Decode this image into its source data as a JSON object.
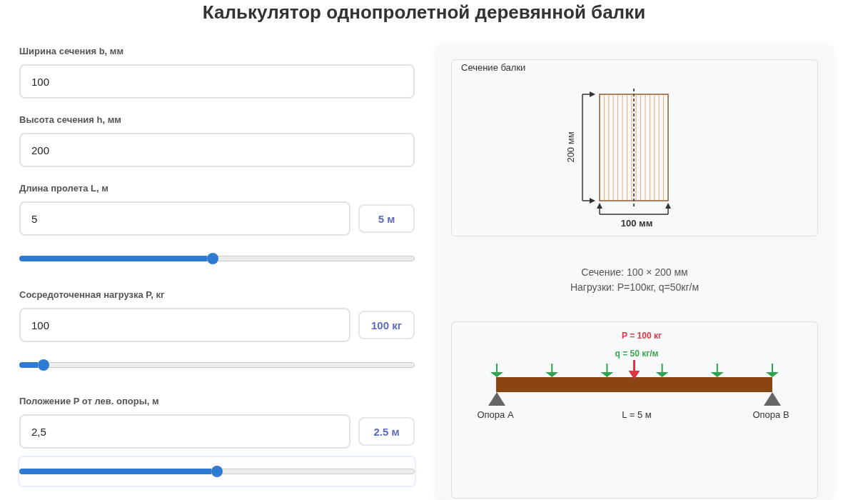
{
  "title": "Калькулятор однопролетной деревянной балки",
  "fields": [
    {
      "kind": "input",
      "label": "Ширина сечения b, мм",
      "value": "100"
    },
    {
      "kind": "input",
      "label": "Высота сечения h, мм",
      "value": "200"
    },
    {
      "kind": "slider",
      "label": "Длина пролета L, м",
      "value": "5",
      "badge": "5 м",
      "level": 0.49,
      "focused": false
    },
    {
      "kind": "slider",
      "label": "Сосредоточенная нагрузка P, кг",
      "value": "100",
      "badge": "100 кг",
      "level": 0.06,
      "focused": false
    },
    {
      "kind": "slider",
      "label": "Положение P от лев. опоры, м",
      "value": "2,5",
      "badge": "2.5 м",
      "level": 0.5,
      "focused": true
    }
  ],
  "section_card": {
    "title": "Сечение балки",
    "height_label": "200 мм",
    "width_label": "100 мм"
  },
  "summary": [
    "Сечение: 100 × 200 мм",
    "Нагрузки: P=100кг, q=50кг/м"
  ],
  "beam_card": {
    "point_load_label": "P = 100 кг",
    "distributed_load_label": "q = 50 кг/м",
    "supports": [
      "Опора A",
      "Опора B"
    ],
    "span_label": "L = 5 м"
  }
}
